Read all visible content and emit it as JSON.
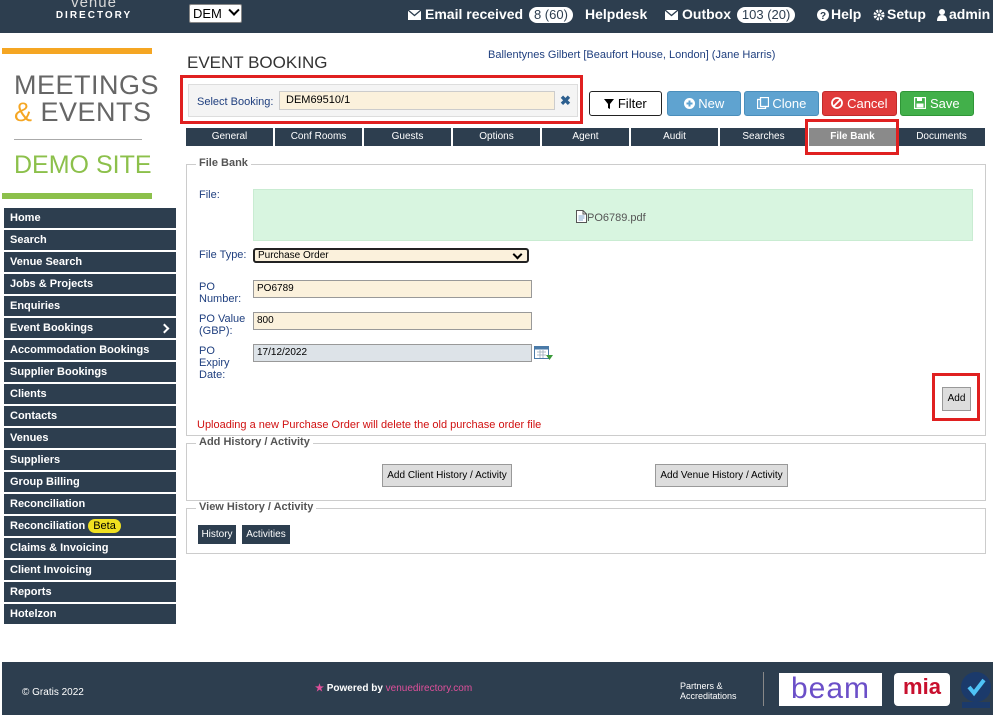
{
  "topbar": {
    "logo_line1": "venue",
    "logo_line2": "DIRECTORY",
    "site_selector": "DEM",
    "email": {
      "label": "Email received",
      "badge": "8 (60)"
    },
    "helpdesk": "Helpdesk",
    "outbox": {
      "label": "Outbox",
      "badge": "103 (20)"
    },
    "help": "Help",
    "setup": "Setup",
    "user": "admin"
  },
  "brand": {
    "meetings": "MEETINGS",
    "amp": "&",
    "events": "EVENTS",
    "demo": "DEMO SITE"
  },
  "sidebar": {
    "items": [
      {
        "label": "Home"
      },
      {
        "label": "Search"
      },
      {
        "label": "Venue Search"
      },
      {
        "label": "Jobs & Projects"
      },
      {
        "label": "Enquiries"
      },
      {
        "label": "Event Bookings"
      },
      {
        "label": "Accommodation Bookings"
      },
      {
        "label": "Supplier Bookings"
      },
      {
        "label": "Clients"
      },
      {
        "label": "Contacts"
      },
      {
        "label": "Venues"
      },
      {
        "label": "Suppliers"
      },
      {
        "label": "Group Billing"
      },
      {
        "label": "Reconciliation"
      },
      {
        "label": "Reconciliation",
        "badge": "Beta"
      },
      {
        "label": "Claims & Invoicing"
      },
      {
        "label": "Client Invoicing"
      },
      {
        "label": "Reports"
      },
      {
        "label": "Hotelzon"
      }
    ]
  },
  "header": {
    "title": "EVENT BOOKING",
    "client_line": "Ballentynes Gilbert [Beaufort House, London] (Jane Harris)",
    "select_label": "Select Booking:",
    "booking_value": "DEM69510/1",
    "clear_glyph": "✖"
  },
  "toolbar": {
    "filter": "Filter",
    "new": "New",
    "clone": "Clone",
    "cancel": "Cancel",
    "save": "Save"
  },
  "tabs": [
    "General",
    "Conf Rooms",
    "Guests",
    "Options",
    "Agent",
    "Audit",
    "Searches",
    "File Bank",
    "Documents"
  ],
  "file_bank": {
    "legend": "File Bank",
    "file_label": "File:",
    "file_name": "PO6789.pdf",
    "file_type_label": "File Type:",
    "file_type_value": "Purchase Order",
    "po_number_label": "PO\nNumber:",
    "po_number_value": "PO6789",
    "po_value_label": "PO Value\n(GBP):",
    "po_value_value": "800",
    "po_expiry_label": "PO\nExpiry\nDate:",
    "po_expiry_value": "17/12/2022",
    "add": "Add",
    "warning": "Uploading a new Purchase Order will delete the old purchase order file"
  },
  "history": {
    "add_legend": "Add History / Activity",
    "add_client": "Add Client History / Activity",
    "add_venue": "Add Venue History / Activity",
    "view_legend": "View History / Activity",
    "history_btn": "History",
    "activities_btn": "Activities"
  },
  "footer": {
    "copyright": "© Gratis 2022",
    "powered_by": "Powered by",
    "powered_site": "venuedirectory.com",
    "partners": "Partners &\nAccreditations",
    "beam": "beam",
    "mia": "mia"
  },
  "colors": {
    "navy": "#2d3e4f",
    "orange": "#f5a623",
    "green": "#8cc04b",
    "highlight_red": "#e02020"
  }
}
